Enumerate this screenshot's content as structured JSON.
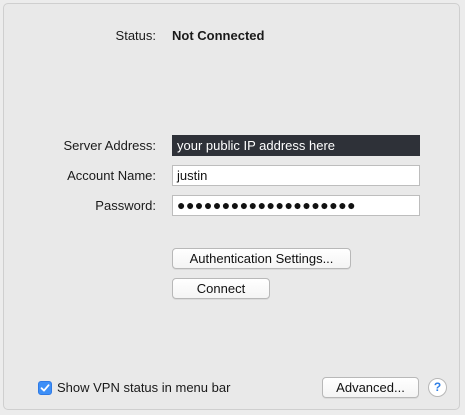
{
  "status": {
    "label": "Status:",
    "value": "Not Connected"
  },
  "form": {
    "server_address": {
      "label": "Server Address:",
      "value": "your public IP address here"
    },
    "account_name": {
      "label": "Account Name:",
      "value": "justin"
    },
    "password": {
      "label": "Password:",
      "value": "●●●●●●●●●●●●●●●●●●●●"
    }
  },
  "buttons": {
    "auth_settings": "Authentication Settings...",
    "connect": "Connect",
    "advanced": "Advanced...",
    "help": "?"
  },
  "footer": {
    "show_status_label": "Show VPN status in menu bar",
    "show_status_checked": true
  },
  "colors": {
    "accent": "#3d8ff7",
    "highlight_field_bg": "#2e3138"
  },
  "icons": {
    "checkmark": "checkmark-icon",
    "help": "help-icon"
  }
}
